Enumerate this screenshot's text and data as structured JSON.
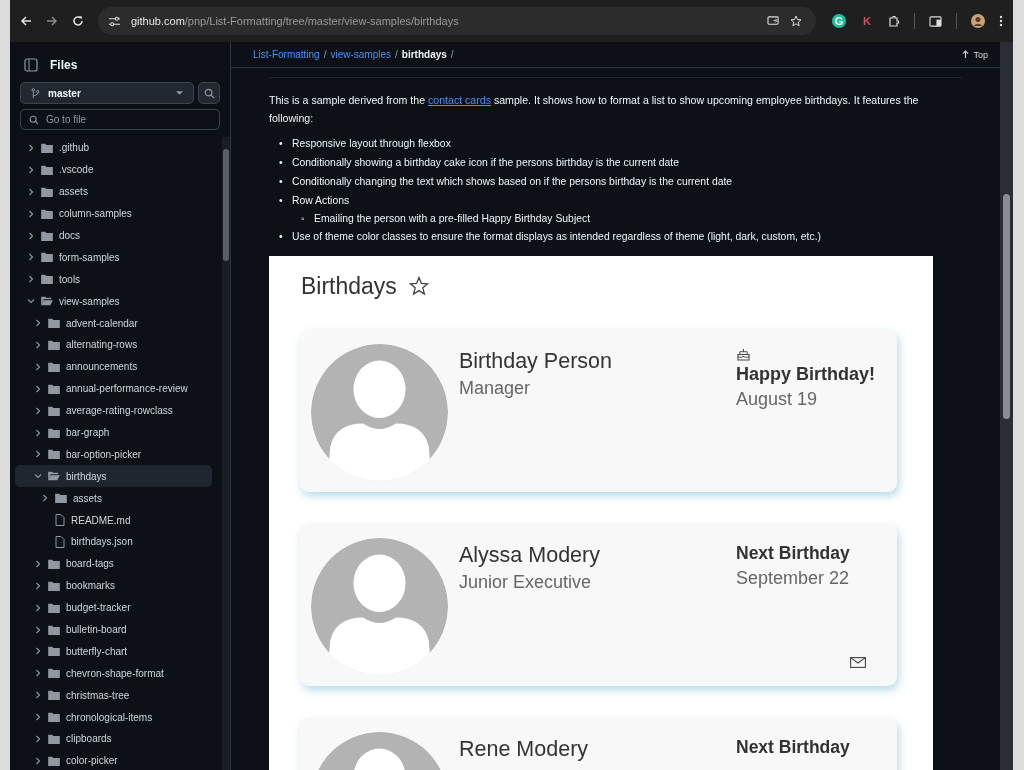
{
  "browser": {
    "url_host": "github.com",
    "url_path": "/pnp/List-Formatting/tree/master/view-samples/birthdays",
    "extensions": [
      "G",
      "K"
    ]
  },
  "sidebar": {
    "title": "Files",
    "branch": "master",
    "search": {
      "placeholder": "Go to file"
    },
    "tree": [
      {
        "label": ".github",
        "kind": "folder",
        "expanded": false,
        "selected": false
      },
      {
        "label": ".vscode",
        "kind": "folder",
        "expanded": false,
        "selected": false
      },
      {
        "label": "assets",
        "kind": "folder",
        "expanded": false,
        "selected": false
      },
      {
        "label": "column-samples",
        "kind": "folder",
        "expanded": false,
        "selected": false
      },
      {
        "label": "docs",
        "kind": "folder",
        "expanded": false,
        "selected": false
      },
      {
        "label": "form-samples",
        "kind": "folder",
        "expanded": false,
        "selected": false
      },
      {
        "label": "tools",
        "kind": "folder",
        "expanded": false,
        "selected": false
      },
      {
        "label": "view-samples",
        "kind": "folder",
        "expanded": true,
        "selected": false,
        "children": [
          {
            "label": "advent-calendar",
            "kind": "folder",
            "expanded": false,
            "selected": false
          },
          {
            "label": "alternating-rows",
            "kind": "folder",
            "expanded": false,
            "selected": false
          },
          {
            "label": "announcements",
            "kind": "folder",
            "expanded": false,
            "selected": false
          },
          {
            "label": "annual-performance-review",
            "kind": "folder",
            "expanded": false,
            "selected": false
          },
          {
            "label": "average-rating-rowclass",
            "kind": "folder",
            "expanded": false,
            "selected": false
          },
          {
            "label": "bar-graph",
            "kind": "folder",
            "expanded": false,
            "selected": false
          },
          {
            "label": "bar-option-picker",
            "kind": "folder",
            "expanded": false,
            "selected": false
          },
          {
            "label": "birthdays",
            "kind": "folder",
            "expanded": true,
            "selected": true,
            "children": [
              {
                "label": "assets",
                "kind": "folder",
                "expanded": false,
                "selected": false
              },
              {
                "label": "README.md",
                "kind": "file",
                "selected": false
              },
              {
                "label": "birthdays.json",
                "kind": "file",
                "selected": false
              }
            ]
          },
          {
            "label": "board-tags",
            "kind": "folder",
            "expanded": false,
            "selected": false
          },
          {
            "label": "bookmarks",
            "kind": "folder",
            "expanded": false,
            "selected": false
          },
          {
            "label": "budget-tracker",
            "kind": "folder",
            "expanded": false,
            "selected": false
          },
          {
            "label": "bulletin-board",
            "kind": "folder",
            "expanded": false,
            "selected": false
          },
          {
            "label": "butterfly-chart",
            "kind": "folder",
            "expanded": false,
            "selected": false
          },
          {
            "label": "chevron-shape-format",
            "kind": "folder",
            "expanded": false,
            "selected": false
          },
          {
            "label": "christmas-tree",
            "kind": "folder",
            "expanded": false,
            "selected": false
          },
          {
            "label": "chronological-items",
            "kind": "folder",
            "expanded": false,
            "selected": false
          },
          {
            "label": "clipboards",
            "kind": "folder",
            "expanded": false,
            "selected": false
          },
          {
            "label": "color-picker",
            "kind": "folder",
            "expanded": false,
            "selected": false
          }
        ]
      }
    ]
  },
  "breadcrumb": {
    "parts": [
      {
        "label": "List-Formatting",
        "kind": "link",
        "separator": "/"
      },
      {
        "label": "view-samples",
        "kind": "link",
        "separator": "/"
      },
      {
        "label": "birthdays",
        "kind": "current",
        "separator": "/"
      }
    ],
    "top_button": "Top"
  },
  "readme": {
    "intro_before": "This is a sample derived from the ",
    "intro_link": "contact cards",
    "intro_after": " sample. It shows how to format a list to show upcoming employee birthdays. It features the following:",
    "bullets": [
      {
        "marker": "•",
        "text": "Responsive layout through flexbox"
      },
      {
        "marker": "•",
        "text": "Conditionally showing a birthday cake icon if the persons birthday is the current date"
      },
      {
        "marker": "•",
        "text": "Conditionally changing the text which shows based on if the persons birthday is the current date"
      },
      {
        "marker": "•",
        "text": "Row Actions",
        "children": [
          {
            "marker": "◦",
            "text": "Emailing the person with a pre-filled Happy Birthday Subject"
          }
        ]
      },
      {
        "marker": "•",
        "text": "Use of theme color classes to ensure the format displays as intended regardless of theme (light, dark, custom, etc.)"
      }
    ]
  },
  "preview": {
    "title": "Birthdays",
    "favorite": false,
    "cards": [
      {
        "name": "Birthday Person",
        "role": "Manager",
        "status": "Happy Birthday!",
        "date": "August 19",
        "today": true,
        "email": false
      },
      {
        "name": "Alyssa Modery",
        "role": "Junior Executive",
        "status": "Next Birthday",
        "date": "September 22",
        "today": false,
        "email": true
      },
      {
        "name": "Rene Modery",
        "status": "Next Birthday"
      }
    ]
  }
}
